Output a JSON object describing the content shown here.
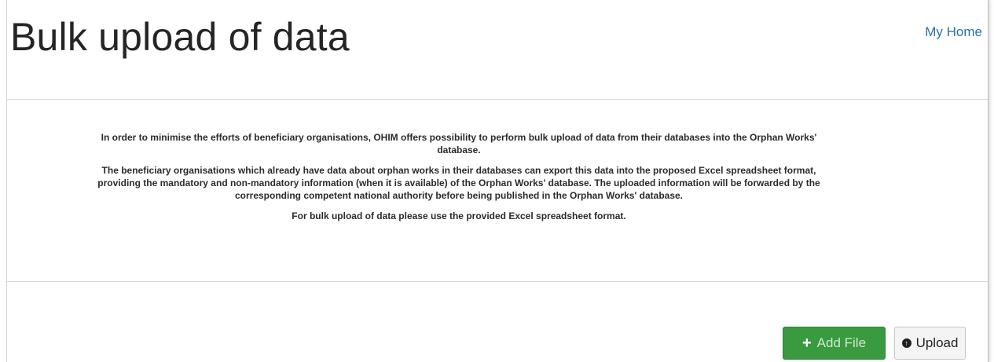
{
  "header": {
    "title": "Bulk upload of data",
    "home_link": "My Home"
  },
  "intro": {
    "paragraphs": [
      "In order to minimise the efforts of beneficiary organisations, OHIM offers possibility to perform bulk upload of data from their databases into the Orphan Works' database.",
      "The beneficiary organisations which already have data about orphan works in their databases can export this data into the proposed Excel spreadsheet format, providing the mandatory and non-mandatory information (when it is available) of the Orphan Works' database. The uploaded information will be forwarded by the corresponding competent national authority before being published in the Orphan Works' database.",
      "For bulk upload of data please use the provided Excel spreadsheet format."
    ]
  },
  "actions": {
    "add_file_label": "Add File",
    "add_file_icon": "plus-icon",
    "upload_label": "Upload",
    "upload_icon": "upload-circle-icon"
  },
  "colors": {
    "link": "#2a6fb0",
    "add_button": "#3a9a3f",
    "upload_button": "#f4f4f4"
  }
}
